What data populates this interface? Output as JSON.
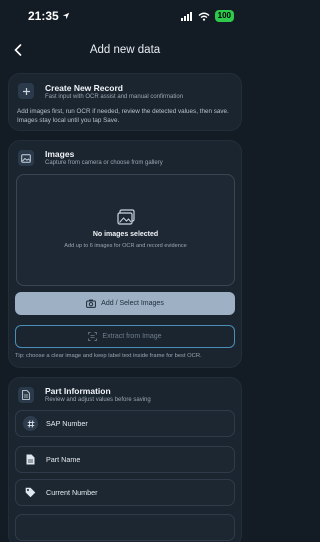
{
  "status_bar": {
    "time": "21:35",
    "battery": "100"
  },
  "nav": {
    "title": "Add new data"
  },
  "create_card": {
    "title": "Create New Record",
    "subtitle": "Fast input with OCR assist and manual confirmation",
    "description": "Add images first, run OCR if needed, review the detected values, then save. Images stay local until you tap Save."
  },
  "images_card": {
    "title": "Images",
    "subtitle": "Capture from camera or choose from gallery",
    "empty_title": "No images selected",
    "empty_subtitle": "Add up to 6 images for OCR and record evidence",
    "add_button": "Add / Select Images",
    "extract_button": "Extract from Image",
    "tip": "Tip: choose a clear image and keep label text inside frame for best OCR."
  },
  "part_card": {
    "title": "Part Information",
    "subtitle": "Review and adjust values before saving",
    "fields": [
      {
        "label": "SAP Number",
        "icon": "hash-icon"
      },
      {
        "label": "Part Name",
        "icon": "document-icon"
      },
      {
        "label": "Current Number",
        "icon": "tag-icon"
      }
    ]
  },
  "colors": {
    "background": "#131b24",
    "card": "#1b2530",
    "primary_button": "#9db0c4",
    "outline_accent": "#4b8fb8",
    "battery": "#2ec84d"
  }
}
